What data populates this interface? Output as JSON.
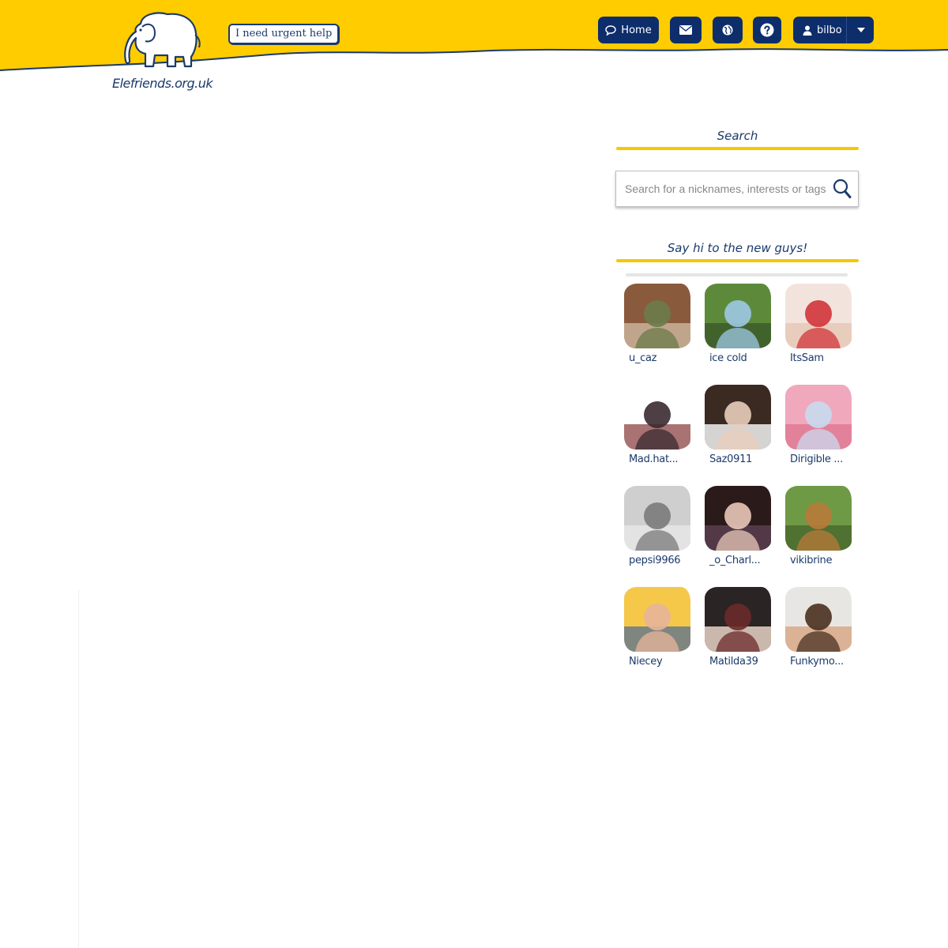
{
  "header": {
    "site_name": "Elefriends.org.uk",
    "urgent_help_label": "I need urgent help",
    "nav": {
      "home_label": "Home",
      "user_label": "bilbo"
    },
    "colors": {
      "band": "#ffcc00",
      "nav": "#0d2d6b",
      "ink": "#1b3a6b"
    }
  },
  "sidebar": {
    "search": {
      "title": "Search",
      "placeholder": "Search for a nicknames, interests or tags"
    },
    "new_users": {
      "title": "Say hi to the new guys!",
      "users": [
        {
          "name": "u_caz",
          "palette": [
            "#8a5a3c",
            "#6b7b4a",
            "#c9b39a"
          ]
        },
        {
          "name": "ice cold",
          "palette": [
            "#5c8a3a",
            "#9cc8e6",
            "#3d5a2a"
          ]
        },
        {
          "name": "ItsSam",
          "palette": [
            "#f2e4dc",
            "#d0343a",
            "#e8c9b6"
          ]
        },
        {
          "name": "Mad.hat...",
          "palette": [
            "#ffffff",
            "#3a2a30",
            "#9a5a5a"
          ]
        },
        {
          "name": "Saz0911",
          "palette": [
            "#3a2a22",
            "#e9cdbb",
            "#f2f2f2"
          ]
        },
        {
          "name": "Dirigible ...",
          "palette": [
            "#f0a8bd",
            "#c9d9ef",
            "#e07a94"
          ]
        },
        {
          "name": "pepsi9966",
          "palette": [
            "#cfcfcf",
            "#7a7a7a",
            "#e6e6e6"
          ]
        },
        {
          "name": "_o_Charl...",
          "palette": [
            "#2a1a1a",
            "#e8c8b8",
            "#5a4050"
          ]
        },
        {
          "name": "vikibrine",
          "palette": [
            "#6e9a46",
            "#b87a38",
            "#4a6a2e"
          ]
        },
        {
          "name": "Niecey",
          "palette": [
            "#f5c84a",
            "#e8b49a",
            "#6a7a8a"
          ]
        },
        {
          "name": "Matilda39",
          "palette": [
            "#2a2424",
            "#6a2a2a",
            "#e8d2c4"
          ]
        },
        {
          "name": "Funkymo...",
          "palette": [
            "#e8e6e2",
            "#4a3020",
            "#d8a888"
          ]
        }
      ]
    }
  }
}
